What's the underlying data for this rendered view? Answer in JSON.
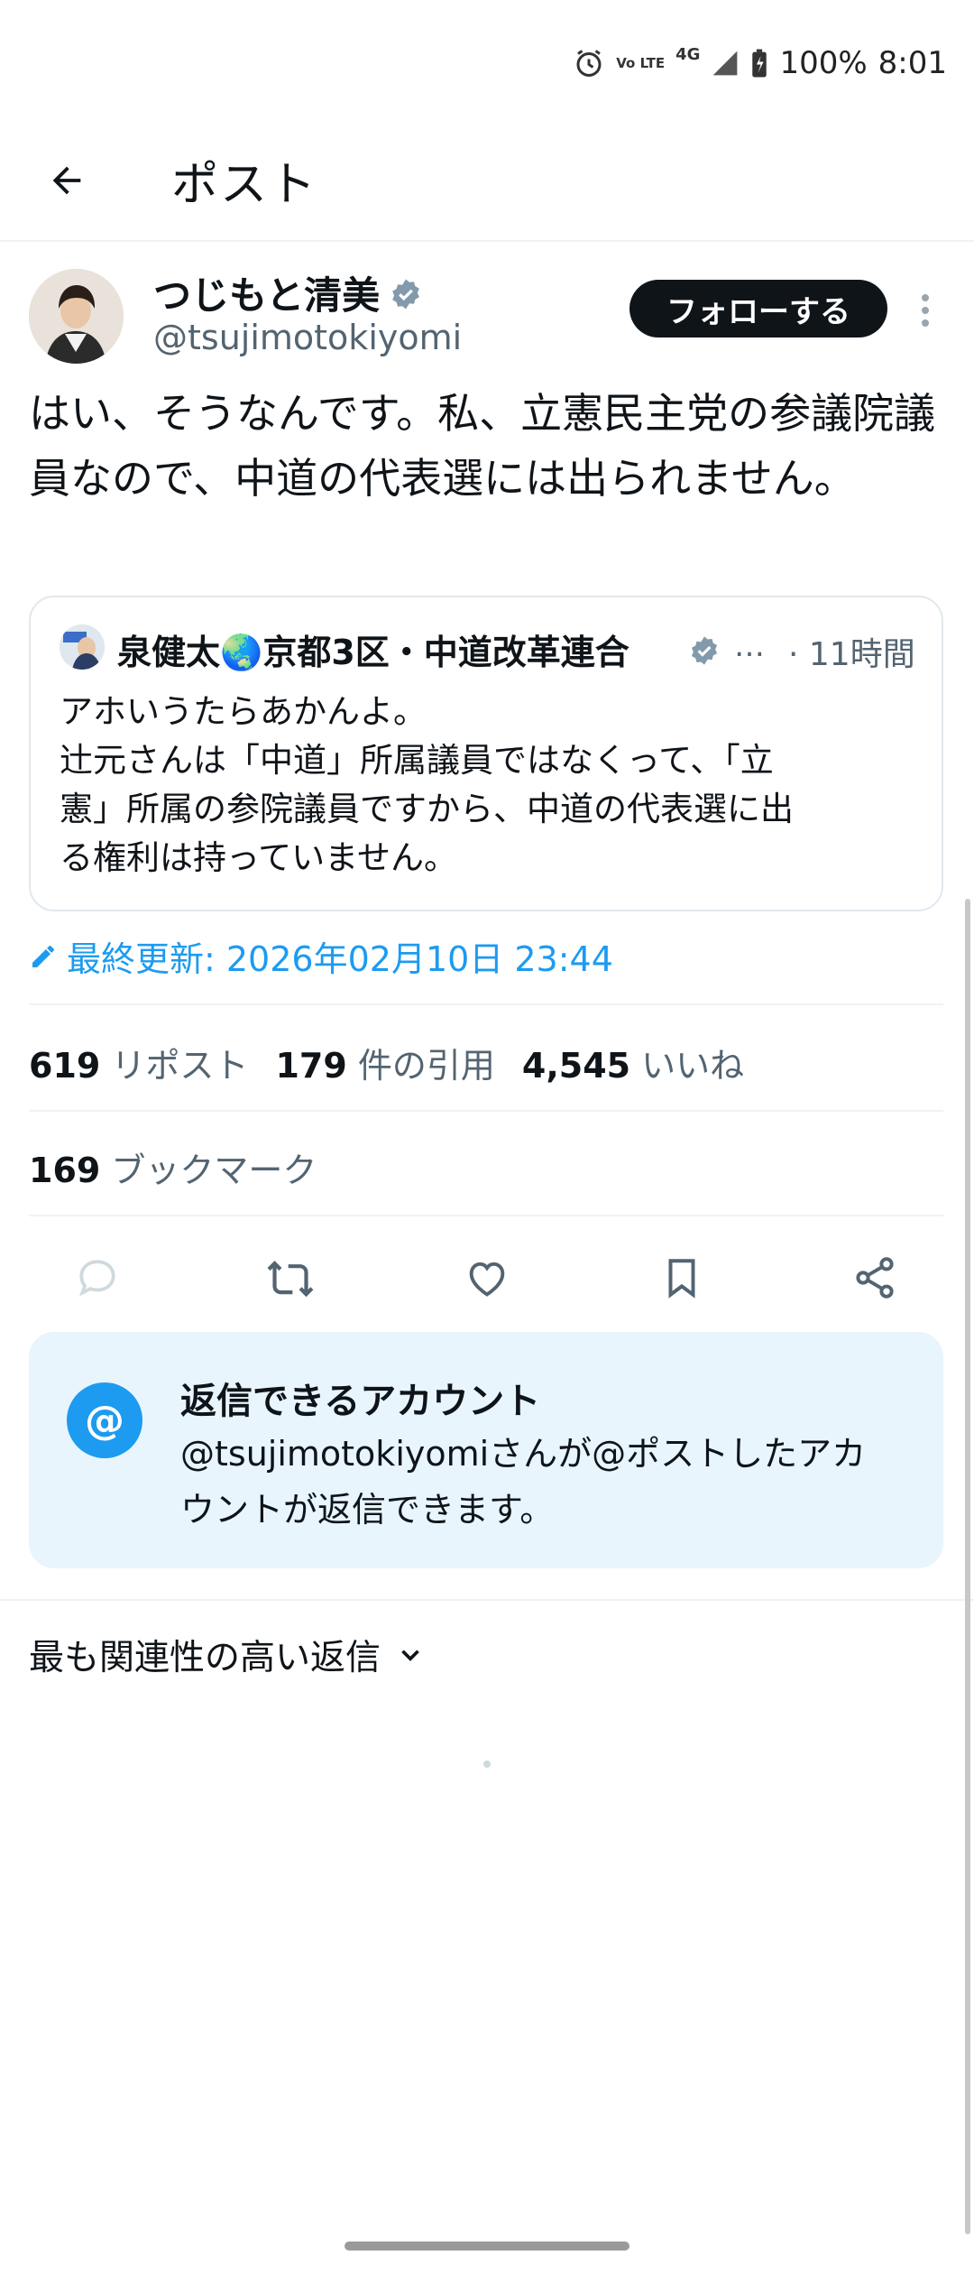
{
  "status_bar": {
    "battery": "100%",
    "time": "8:01",
    "network": "4G",
    "volte": "Vo LTE"
  },
  "header": {
    "title": "ポスト"
  },
  "author": {
    "name": "つじもと清美",
    "handle": "@tsujimotokiyomi",
    "follow_label": "フォローする"
  },
  "tweet": {
    "text": "はい、そうなんです。私、立憲民主党の参議院議員なので、中道の代表選には出られません。"
  },
  "quote": {
    "name": "泉健太🌏京都3区・中道改革連合",
    "ellipsis": "…",
    "time": "· 11時間",
    "text_lines": [
      "アホいうたらあかんよ。",
      "辻元さんは「中道」所属議員ではなくって、「立",
      "憲」所属の参院議員ですから、中道の代表選に出",
      "る権利は持っていません。"
    ]
  },
  "updated": {
    "text": "最終更新: 2026年02月10日 23:44"
  },
  "stats": {
    "reposts": {
      "count": "619",
      "label": "リポスト"
    },
    "quotes": {
      "count": "179",
      "label": "件の引用"
    },
    "likes": {
      "count": "4,545",
      "label": "いいね"
    },
    "bookmarks": {
      "count": "169",
      "label": "ブックマーク"
    }
  },
  "reply_settings": {
    "title": "返信できるアカウント",
    "desc_lines": [
      "@tsujimotokiyomiさんが@ポストしたアカ",
      "ウントが返信できます。"
    ]
  },
  "replies": {
    "sort_label": "最も関連性の高い返信"
  },
  "colors": {
    "accent": "#1d9bf0",
    "text": "#0f1419",
    "muted": "#536471",
    "reply_card_bg": "#e8f5fd"
  }
}
